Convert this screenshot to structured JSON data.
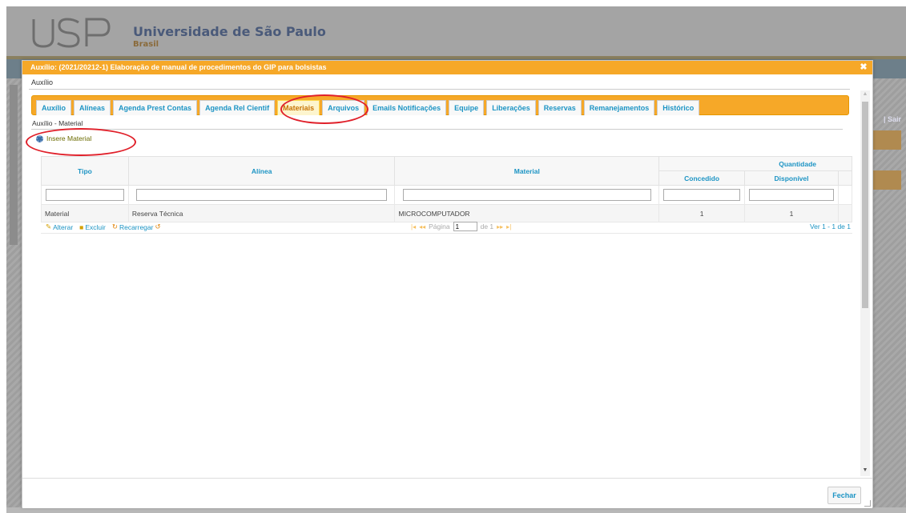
{
  "header": {
    "university": "Universidade de São Paulo",
    "country": "Brasil",
    "logo_text": "USP",
    "right_link": "| Sair"
  },
  "dialog": {
    "title": "Auxílio: (2021/20212-1) Elaboração de manual de procedimentos do GIP para bolsistas",
    "section_label": "Auxílio",
    "tabs": [
      {
        "label": "Auxílio",
        "active": false
      },
      {
        "label": "Alíneas",
        "active": false
      },
      {
        "label": "Agenda Prest Contas",
        "active": false
      },
      {
        "label": "Agenda Rel Cientif",
        "active": false
      },
      {
        "label": "Materiais",
        "active": true
      },
      {
        "label": "Arquivos",
        "active": false
      },
      {
        "label": "Emails Notificações",
        "active": false
      },
      {
        "label": "Equipe",
        "active": false
      },
      {
        "label": "Liberações",
        "active": false
      },
      {
        "label": "Reservas",
        "active": false
      },
      {
        "label": "Remanejamentos",
        "active": false
      },
      {
        "label": "Histórico",
        "active": false
      }
    ],
    "breadcrumb": "Auxílio - Material",
    "insert_button": "Insere Material",
    "grid": {
      "columns": {
        "tipo": "Tipo",
        "alinea": "Alínea",
        "material": "Material",
        "quantidade": "Quantidade",
        "concedido": "Concedido",
        "disponivel": "Disponível"
      },
      "rows": [
        {
          "tipo": "Material",
          "alinea": "Reserva Técnica",
          "material": "MICROCOMPUTADOR",
          "concedido": "1",
          "disponivel": "1"
        }
      ]
    },
    "pager": {
      "alterar": "Alterar",
      "excluir": "Excluir",
      "recarregar": "Recarregar",
      "pagina_label": "Página",
      "page_value": "1",
      "de_label": "de 1",
      "range_text": "Ver 1 - 1 de 1"
    },
    "close_button": "Fechar"
  },
  "colors": {
    "title_bar": "#f6a828",
    "tab_text": "#1c94c4",
    "annotation": "#e0202a"
  }
}
